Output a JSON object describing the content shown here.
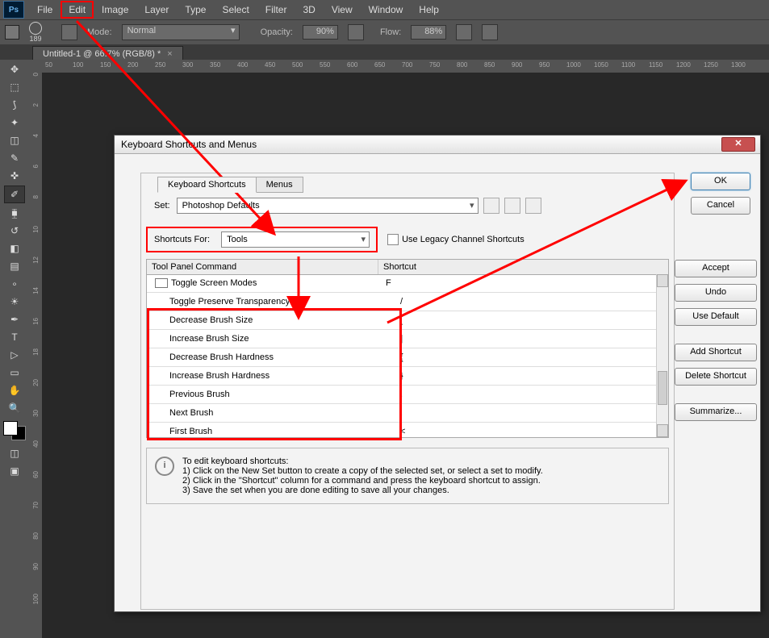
{
  "app": {
    "logo": "Ps"
  },
  "menu": {
    "file": "File",
    "edit": "Edit",
    "image": "Image",
    "layer": "Layer",
    "type": "Type",
    "select": "Select",
    "filter": "Filter",
    "threeD": "3D",
    "view": "View",
    "window": "Window",
    "help": "Help"
  },
  "opt": {
    "brush_size": "189",
    "mode_label": "Mode:",
    "mode_value": "Normal",
    "opacity_label": "Opacity:",
    "opacity_value": "90%",
    "flow_label": "Flow:",
    "flow_value": "88%"
  },
  "doc": {
    "tab": "Untitled-1 @ 66.7% (RGB/8) *"
  },
  "ruler": {
    "marks": [
      "50",
      "100",
      "150",
      "200",
      "250",
      "300",
      "350",
      "400",
      "450",
      "500",
      "550",
      "600",
      "650",
      "700",
      "750",
      "800",
      "850",
      "900",
      "950",
      "1000",
      "1050",
      "1100",
      "1150",
      "1200",
      "1250",
      "1300"
    ],
    "vmarks": [
      "0",
      "2",
      "4",
      "6",
      "8",
      "1 0",
      "1 2",
      "1 4",
      "1 6",
      "1 8",
      "2 0",
      "3 0",
      "4 0",
      "6 0",
      "7 0",
      "8 0",
      "9 0",
      "1 0 0"
    ]
  },
  "dlg": {
    "title": "Keyboard Shortcuts and Menus",
    "ok": "OK",
    "cancel": "Cancel",
    "tab1": "Keyboard Shortcuts",
    "tab2": "Menus",
    "set_label": "Set:",
    "set_value": "Photoshop Defaults",
    "sf_label": "Shortcuts For:",
    "sf_value": "Tools",
    "legacy": "Use Legacy Channel Shortcuts",
    "col1": "Tool Panel Command",
    "col2": "Shortcut",
    "rows": [
      {
        "c": "Toggle Screen Modes",
        "s": "F"
      },
      {
        "c": "Toggle Preserve Transparency",
        "s": "/"
      },
      {
        "c": "Decrease Brush Size",
        "s": "["
      },
      {
        "c": "Increase Brush Size",
        "s": "]"
      },
      {
        "c": "Decrease Brush Hardness",
        "s": "{"
      },
      {
        "c": "Increase Brush Hardness",
        "s": "}"
      },
      {
        "c": "Previous Brush",
        "s": ","
      },
      {
        "c": "Next Brush",
        "s": "."
      },
      {
        "c": "First Brush",
        "s": "<"
      }
    ],
    "accept": "Accept",
    "undo": "Undo",
    "usedef": "Use Default",
    "addsc": "Add Shortcut",
    "delsc": "Delete Shortcut",
    "summ": "Summarize...",
    "info_title": "To edit keyboard shortcuts:",
    "info_1": "1) Click on the New Set button to create a copy of the selected set, or select a set to modify.",
    "info_2": "2) Click in the \"Shortcut\" column for a command and press the keyboard shortcut to assign.",
    "info_3": "3) Save the set when you are done editing to save all your changes."
  }
}
